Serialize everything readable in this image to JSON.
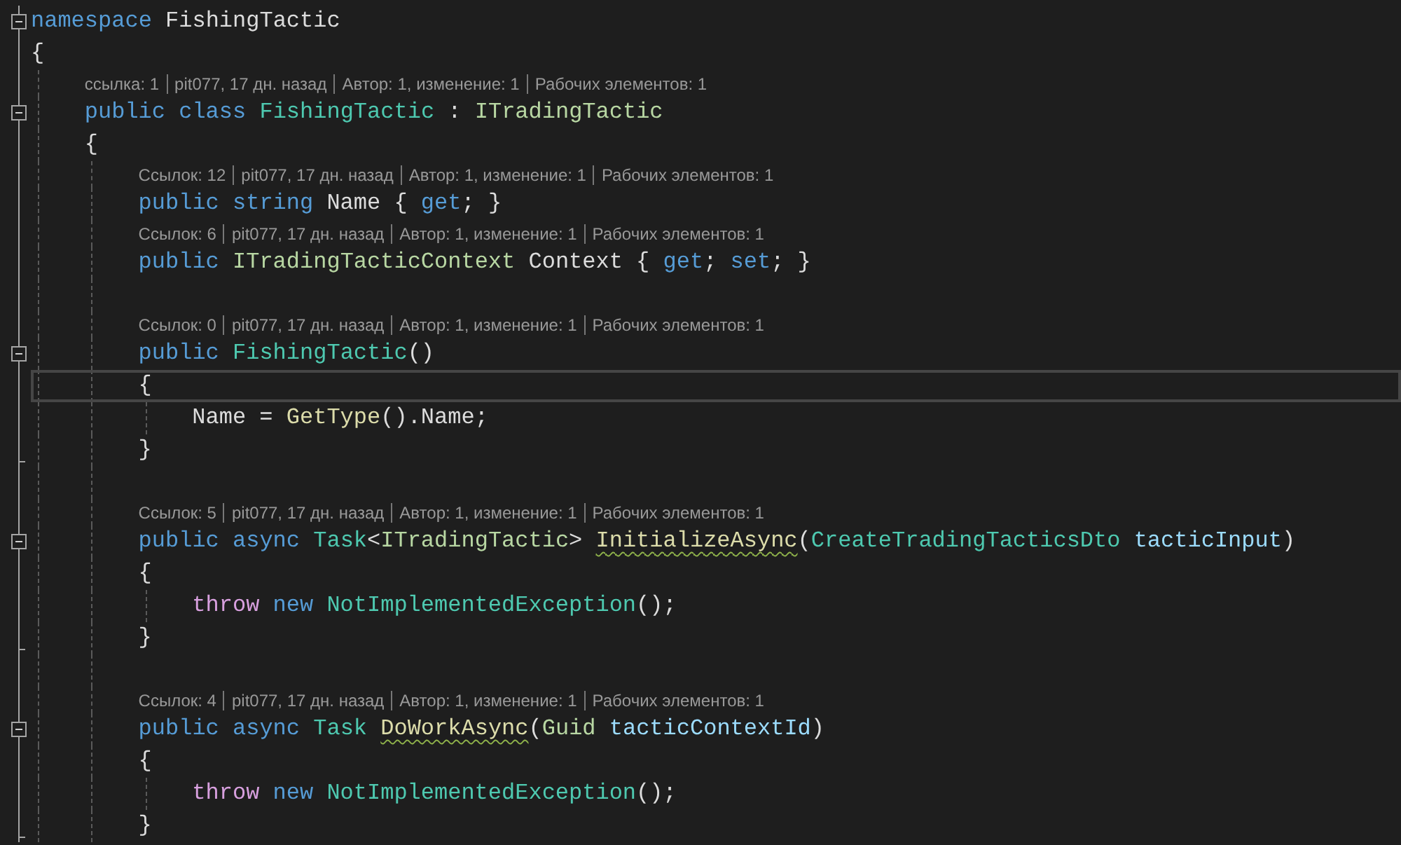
{
  "lines": [
    {
      "kind": "code",
      "collapsible": true,
      "region_end": false,
      "current": false,
      "tokens": [
        {
          "t": "namespace ",
          "kind": "keyword"
        },
        {
          "t": "FishingTactic",
          "kind": "plain"
        }
      ]
    },
    {
      "kind": "code",
      "collapsible": false,
      "region_end": false,
      "current": false,
      "tokens": [
        {
          "t": "{",
          "kind": "plain"
        }
      ],
      "children": [
        {
          "kind": "lens",
          "parts": [
            "ссылка: 1",
            "pit077, 17 дн. назад",
            "Автор: 1, изменение: 1",
            "Рабочих элементов: 1"
          ]
        },
        {
          "kind": "code",
          "collapsible": true,
          "region_end": false,
          "current": false,
          "tokens": [
            {
              "t": "public class ",
              "kind": "keyword"
            },
            {
              "t": "FishingTactic",
              "kind": "type"
            },
            {
              "t": " : ",
              "kind": "plain"
            },
            {
              "t": "ITradingTactic",
              "kind": "interface"
            }
          ]
        },
        {
          "kind": "code",
          "collapsible": false,
          "region_end": false,
          "current": false,
          "tokens": [
            {
              "t": "{",
              "kind": "plain"
            }
          ],
          "children": [
            {
              "kind": "lens",
              "parts": [
                "Ссылок: 12",
                "pit077, 17 дн. назад",
                "Автор: 1, изменение: 1",
                "Рабочих элементов: 1"
              ]
            },
            {
              "kind": "code",
              "collapsible": false,
              "region_end": false,
              "current": false,
              "tokens": [
                {
                  "t": "public string ",
                  "kind": "keyword"
                },
                {
                  "t": "Name { ",
                  "kind": "plain"
                },
                {
                  "t": "get",
                  "kind": "keyword"
                },
                {
                  "t": "; }",
                  "kind": "plain"
                }
              ]
            },
            {
              "kind": "lens",
              "parts": [
                "Ссылок: 6",
                "pit077, 17 дн. назад",
                "Автор: 1, изменение: 1",
                "Рабочих элементов: 1"
              ]
            },
            {
              "kind": "code",
              "collapsible": false,
              "region_end": false,
              "current": false,
              "tokens": [
                {
                  "t": "public ",
                  "kind": "keyword"
                },
                {
                  "t": "ITradingTacticContext",
                  "kind": "interface"
                },
                {
                  "t": " Context { ",
                  "kind": "plain"
                },
                {
                  "t": "get",
                  "kind": "keyword"
                },
                {
                  "t": "; ",
                  "kind": "plain"
                },
                {
                  "t": "set",
                  "kind": "keyword"
                },
                {
                  "t": "; }",
                  "kind": "plain"
                }
              ]
            },
            {
              "kind": "blank"
            },
            {
              "kind": "lens",
              "parts": [
                "Ссылок: 0",
                "pit077, 17 дн. назад",
                "Автор: 1, изменение: 1",
                "Рабочих элементов: 1"
              ]
            },
            {
              "kind": "code",
              "collapsible": true,
              "region_end": false,
              "current": false,
              "tokens": [
                {
                  "t": "public ",
                  "kind": "keyword"
                },
                {
                  "t": "FishingTactic",
                  "kind": "type"
                },
                {
                  "t": "()",
                  "kind": "plain"
                }
              ]
            },
            {
              "kind": "code",
              "collapsible": false,
              "region_end": false,
              "current": true,
              "tokens": [
                {
                  "t": "{",
                  "kind": "plain"
                }
              ],
              "children": [
                {
                  "kind": "code",
                  "collapsible": false,
                  "region_end": false,
                  "current": false,
                  "tokens": [
                    {
                      "t": "Name = ",
                      "kind": "plain"
                    },
                    {
                      "t": "GetType",
                      "kind": "method"
                    },
                    {
                      "t": "().Name;",
                      "kind": "plain"
                    }
                  ]
                }
              ]
            },
            {
              "kind": "code",
              "collapsible": false,
              "region_end": true,
              "current": false,
              "tokens": [
                {
                  "t": "}",
                  "kind": "plain"
                }
              ]
            },
            {
              "kind": "blank"
            },
            {
              "kind": "lens",
              "parts": [
                "Ссылок: 5",
                "pit077, 17 дн. назад",
                "Автор: 1, изменение: 1",
                "Рабочих элементов: 1"
              ]
            },
            {
              "kind": "code",
              "collapsible": true,
              "region_end": false,
              "current": false,
              "tokens": [
                {
                  "t": "public async ",
                  "kind": "keyword"
                },
                {
                  "t": "Task",
                  "kind": "type"
                },
                {
                  "t": "<",
                  "kind": "plain"
                },
                {
                  "t": "ITradingTactic",
                  "kind": "interface"
                },
                {
                  "t": "> ",
                  "kind": "plain"
                },
                {
                  "t": "InitializeAsync",
                  "kind": "method",
                  "squiggle": true
                },
                {
                  "t": "(",
                  "kind": "plain"
                },
                {
                  "t": "CreateTradingTacticsDto ",
                  "kind": "type"
                },
                {
                  "t": "tacticInput",
                  "kind": "param"
                },
                {
                  "t": ")",
                  "kind": "plain"
                }
              ]
            },
            {
              "kind": "code",
              "collapsible": false,
              "region_end": false,
              "current": false,
              "tokens": [
                {
                  "t": "{",
                  "kind": "plain"
                }
              ],
              "children": [
                {
                  "kind": "code",
                  "collapsible": false,
                  "region_end": false,
                  "current": false,
                  "tokens": [
                    {
                      "t": "throw ",
                      "kind": "control"
                    },
                    {
                      "t": "new ",
                      "kind": "keyword"
                    },
                    {
                      "t": "NotImplementedException",
                      "kind": "type"
                    },
                    {
                      "t": "();",
                      "kind": "plain"
                    }
                  ]
                }
              ]
            },
            {
              "kind": "code",
              "collapsible": false,
              "region_end": true,
              "current": false,
              "tokens": [
                {
                  "t": "}",
                  "kind": "plain"
                }
              ]
            },
            {
              "kind": "blank"
            },
            {
              "kind": "lens",
              "parts": [
                "Ссылок: 4",
                "pit077, 17 дн. назад",
                "Автор: 1, изменение: 1",
                "Рабочих элементов: 1"
              ]
            },
            {
              "kind": "code",
              "collapsible": true,
              "region_end": false,
              "current": false,
              "tokens": [
                {
                  "t": "public async ",
                  "kind": "keyword"
                },
                {
                  "t": "Task ",
                  "kind": "type"
                },
                {
                  "t": "DoWorkAsync",
                  "kind": "method",
                  "squiggle": true
                },
                {
                  "t": "(",
                  "kind": "plain"
                },
                {
                  "t": "Guid ",
                  "kind": "interface"
                },
                {
                  "t": "tacticContextId",
                  "kind": "param"
                },
                {
                  "t": ")",
                  "kind": "plain"
                }
              ]
            },
            {
              "kind": "code",
              "collapsible": false,
              "region_end": false,
              "current": false,
              "tokens": [
                {
                  "t": "{",
                  "kind": "plain"
                }
              ],
              "children": [
                {
                  "kind": "code",
                  "collapsible": false,
                  "region_end": false,
                  "current": false,
                  "tokens": [
                    {
                      "t": "throw ",
                      "kind": "control"
                    },
                    {
                      "t": "new ",
                      "kind": "keyword"
                    },
                    {
                      "t": "NotImplementedException",
                      "kind": "type"
                    },
                    {
                      "t": "();",
                      "kind": "plain"
                    }
                  ]
                }
              ]
            },
            {
              "kind": "code",
              "collapsible": false,
              "region_end": true,
              "current": false,
              "tokens": [
                {
                  "t": "}",
                  "kind": "plain"
                }
              ]
            }
          ]
        }
      ]
    }
  ]
}
